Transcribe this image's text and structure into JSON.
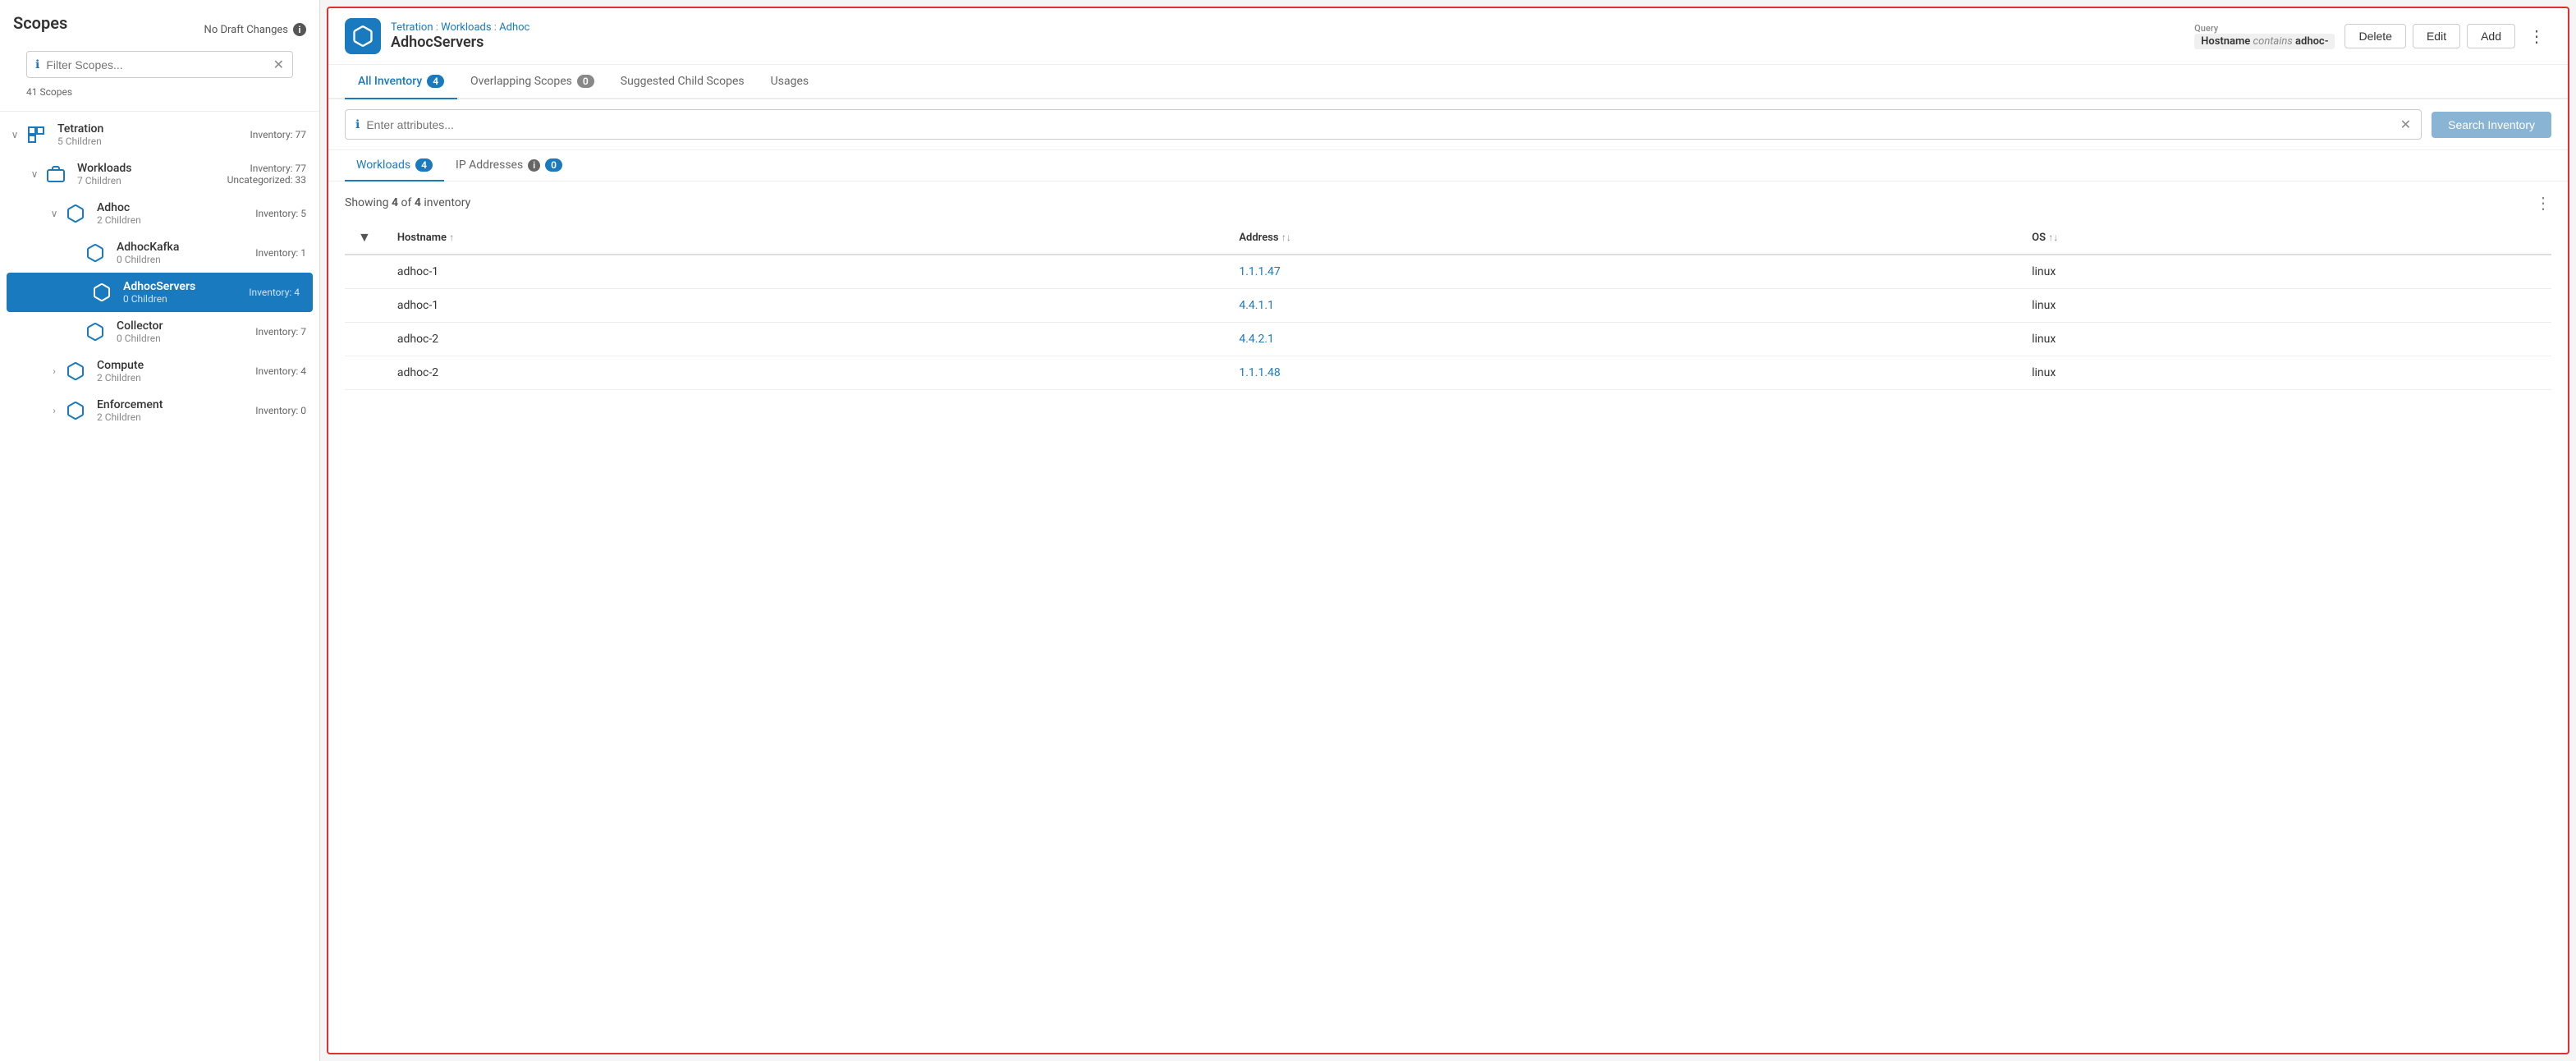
{
  "sidebar": {
    "title": "Scopes",
    "draft_status": "No Draft Changes",
    "filter_placeholder": "Filter Scopes...",
    "scope_count": "41 Scopes",
    "scopes": [
      {
        "id": "tetration",
        "name": "Tetration",
        "children_count": "5 Children",
        "inventory": "Inventory: 77",
        "collapsed": false,
        "indent": 0,
        "has_collapse": true
      },
      {
        "id": "workloads",
        "name": "Workloads",
        "children_count": "7 Children",
        "inventory": "Inventory: 77",
        "inventory2": "Uncategorized: 33",
        "collapsed": false,
        "indent": 1,
        "has_collapse": true
      },
      {
        "id": "adhoc",
        "name": "Adhoc",
        "children_count": "2 Children",
        "inventory": "Inventory: 5",
        "collapsed": false,
        "indent": 2,
        "has_collapse": true
      },
      {
        "id": "adhockafka",
        "name": "AdhocKafka",
        "children_count": "0 Children",
        "inventory": "Inventory: 1",
        "collapsed": false,
        "indent": 3,
        "active": false
      },
      {
        "id": "adhocservers",
        "name": "AdhocServers",
        "children_count": "0 Children",
        "inventory": "Inventory: 4",
        "collapsed": false,
        "indent": 3,
        "active": true
      },
      {
        "id": "collector",
        "name": "Collector",
        "children_count": "0 Children",
        "inventory": "Inventory: 7",
        "collapsed": false,
        "indent": 3,
        "active": false
      },
      {
        "id": "compute",
        "name": "Compute",
        "children_count": "2 Children",
        "inventory": "Inventory: 4",
        "collapsed": true,
        "indent": 2,
        "has_collapse": true
      },
      {
        "id": "enforcement",
        "name": "Enforcement",
        "children_count": "2 Children",
        "inventory": "Inventory: 0",
        "collapsed": true,
        "indent": 2,
        "has_collapse": true
      }
    ]
  },
  "panel": {
    "breadcrumb": [
      "Tetration",
      "Workloads",
      "Adhoc"
    ],
    "title": "AdhocServers",
    "query_label": "Query",
    "query_hostname_label": "Hostname",
    "query_op": "contains",
    "query_value": "adhoc-",
    "actions": {
      "delete": "Delete",
      "edit": "Edit",
      "add": "Add"
    },
    "tabs": [
      {
        "id": "all-inventory",
        "label": "All Inventory",
        "badge": "4",
        "active": true
      },
      {
        "id": "overlapping-scopes",
        "label": "Overlapping Scopes",
        "badge": "0",
        "active": false
      },
      {
        "id": "suggested-child-scopes",
        "label": "Suggested Child Scopes",
        "badge": null,
        "active": false
      },
      {
        "id": "usages",
        "label": "Usages",
        "badge": null,
        "active": false
      }
    ],
    "search_placeholder": "Enter attributes...",
    "search_button": "Search Inventory",
    "sub_tabs": [
      {
        "id": "workloads",
        "label": "Workloads",
        "badge": "4",
        "active": true
      },
      {
        "id": "ip-addresses",
        "label": "IP Addresses",
        "badge": "0",
        "active": false
      }
    ],
    "showing": {
      "text": "Showing",
      "current": "4",
      "separator": "of",
      "total": "4",
      "suffix": "inventory"
    },
    "table": {
      "columns": [
        {
          "id": "filter",
          "label": ""
        },
        {
          "id": "hostname",
          "label": "Hostname",
          "sort": "↑"
        },
        {
          "id": "address",
          "label": "Address",
          "sort": "↑↓"
        },
        {
          "id": "os",
          "label": "OS",
          "sort": "↑↓"
        }
      ],
      "rows": [
        {
          "hostname": "adhoc-1",
          "address": "1.1.1.47",
          "os": "linux"
        },
        {
          "hostname": "adhoc-1",
          "address": "4.4.1.1",
          "os": "linux"
        },
        {
          "hostname": "adhoc-2",
          "address": "4.4.2.1",
          "os": "linux"
        },
        {
          "hostname": "adhoc-2",
          "address": "1.1.1.48",
          "os": "linux"
        }
      ]
    }
  }
}
